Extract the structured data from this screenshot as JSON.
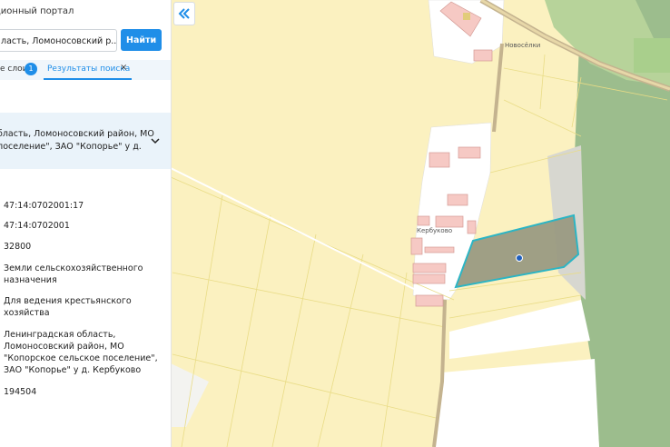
{
  "header": {
    "portal_title": "ционный портал"
  },
  "search": {
    "value": "ласть, Ломоносовский р...",
    "button_label": "Найти"
  },
  "tabs": {
    "layers_label": "е слои",
    "layers_count": "1",
    "results_label": "Результаты поиска",
    "close_symbol": "×"
  },
  "result": {
    "line1": "бласть, Ломоносовский район, МО",
    "line2": "поселение\", ЗАО \"Копорье\" у д."
  },
  "attributes": {
    "cadastral_number": "47:14:0702001:17",
    "quarter": "47:14:0702001",
    "area": "32800",
    "category_line1": "Земли сельскохозяйственного",
    "category_line2": "назначения",
    "use_line1": "Для ведения крестьянского",
    "use_line2": "хозяйства",
    "address_line1": "Ленинградская область,",
    "address_line2": "Ломоносовский район, МО",
    "address_line3": "\"Копорское сельское поселение\",",
    "address_line4": "ЗАО \"Копорье\" у д. Кербуково",
    "cost": "194504"
  },
  "map": {
    "labels": {
      "novoselki": "Новосёлки",
      "kerbukovo": "Кербуково"
    },
    "colors": {
      "field": "#fbf1c0",
      "forest": "#9cbd8d",
      "parcel": "#9a9a82",
      "parcel_border": "#2cb5c4",
      "building": "#f6c9c4",
      "road": "#c4b38f"
    }
  },
  "icons": {
    "collapse": "double-chevron-left-icon",
    "expand": "chevron-down-icon",
    "marker": "location-dot-icon"
  }
}
